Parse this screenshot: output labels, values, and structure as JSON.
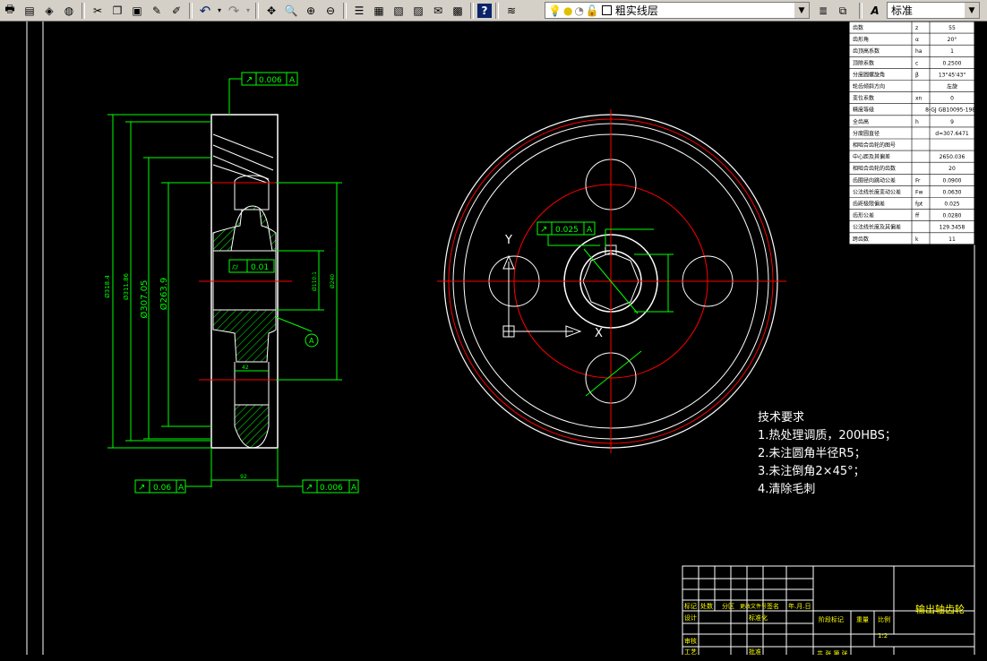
{
  "toolbar": {
    "layer_name": "粗实线层",
    "text_style": "标准",
    "icons": [
      "print-icon",
      "print-preview-icon",
      "publish-icon",
      "web-icon",
      "cut-icon",
      "copy-icon",
      "paste-icon",
      "match-properties-icon",
      "brush-icon",
      "undo-icon",
      "redo-icon",
      "pan-icon",
      "zoom-realtime-icon",
      "zoom-window-icon",
      "zoom-previous-icon",
      "properties-icon",
      "design-center-icon",
      "tool-palette-icon",
      "sheet-set-icon",
      "markup-icon",
      "calculator-icon",
      "help-icon",
      "layer-manager-icon",
      "bulb-icon",
      "sun-icon",
      "lock-icon",
      "layer-state-icon",
      "text-style-icon"
    ]
  },
  "tolerances": {
    "top": "0.006",
    "top_ref": "A",
    "mid": "0.01",
    "left_bottom": "0.06",
    "left_bottom_ref": "A",
    "right_bottom": "0.006",
    "right_bottom_ref": "A",
    "front": "0.025",
    "front_ref": "A",
    "datum": "A"
  },
  "dimensions": {
    "d1": "Ø318.4",
    "d2": "Ø311.86",
    "d3": "Ø307.05",
    "d4": "Ø263.9",
    "d5": "Ø110.1",
    "d6": "Ø240",
    "width": "92",
    "hub": "42"
  },
  "axes": {
    "y": "Y",
    "x": "X"
  },
  "param_table": [
    {
      "name": "齿数",
      "sym": "z",
      "val": "55"
    },
    {
      "name": "齿形角",
      "sym": "α",
      "val": "20°"
    },
    {
      "name": "齿顶高系数",
      "sym": "ha",
      "val": "1"
    },
    {
      "name": "顶隙系数",
      "sym": "c",
      "val": "0.2500"
    },
    {
      "name": "分度圆螺旋角",
      "sym": "β",
      "val": "13°45'43\""
    },
    {
      "name": "轮齿倾斜方向",
      "sym": "",
      "val": "左旋"
    },
    {
      "name": "变位系数",
      "sym": "xn",
      "val": "0"
    },
    {
      "name": "精度等级",
      "sym": "",
      "val": "8-GJ GB10095-1988"
    },
    {
      "name": "全齿高",
      "sym": "h",
      "val": "9"
    },
    {
      "name": "分度圆直径",
      "sym": "",
      "val": "d=307.6471"
    },
    {
      "name": "相啮合齿轮的图号",
      "sym": "",
      "val": ""
    },
    {
      "name": "中心距及其偏差",
      "sym": "",
      "val": "2650.036"
    },
    {
      "name": "相啮合齿轮的齿数",
      "sym": "",
      "val": "20"
    },
    {
      "name": "齿圈径向跳动公差",
      "sym": "Fr",
      "val": "0.0900"
    },
    {
      "name": "公法线长度变动公差",
      "sym": "Fw",
      "val": "0.0630"
    },
    {
      "name": "齿距极限偏差",
      "sym": "fpt",
      "val": "0.025"
    },
    {
      "name": "齿形公差",
      "sym": "ff",
      "val": "0.0280"
    },
    {
      "name": "公法线长度及其偏差",
      "sym": "",
      "val": "129.3458"
    },
    {
      "name": "跨齿数",
      "sym": "k",
      "val": "11"
    }
  ],
  "tech_req": {
    "title": "技术要求",
    "items": [
      "1.热处理调质，200HBS；",
      "2.未注圆角半径R5；",
      "3.未注倒角2×45°；",
      "4.清除毛刺"
    ]
  },
  "title_block": {
    "drawing_name": "输出轴齿轮",
    "h_mark": "标记",
    "h_count": "处数",
    "h_zone": "分区",
    "h_doc": "更改文件号",
    "h_sign": "签名",
    "h_date": "年.月.日",
    "design": "设计",
    "standard": "标准化",
    "stage": "阶段标记",
    "weight": "重量",
    "scale_label": "比例",
    "scale": "1:2",
    "review": "审核",
    "process": "工艺",
    "approve": "批准",
    "sheets": "共 张 第 张"
  },
  "colors": {
    "outline": "#ffffff",
    "dim": "#00ff00",
    "center": "#ff0000",
    "hatch": "#00ff00"
  }
}
